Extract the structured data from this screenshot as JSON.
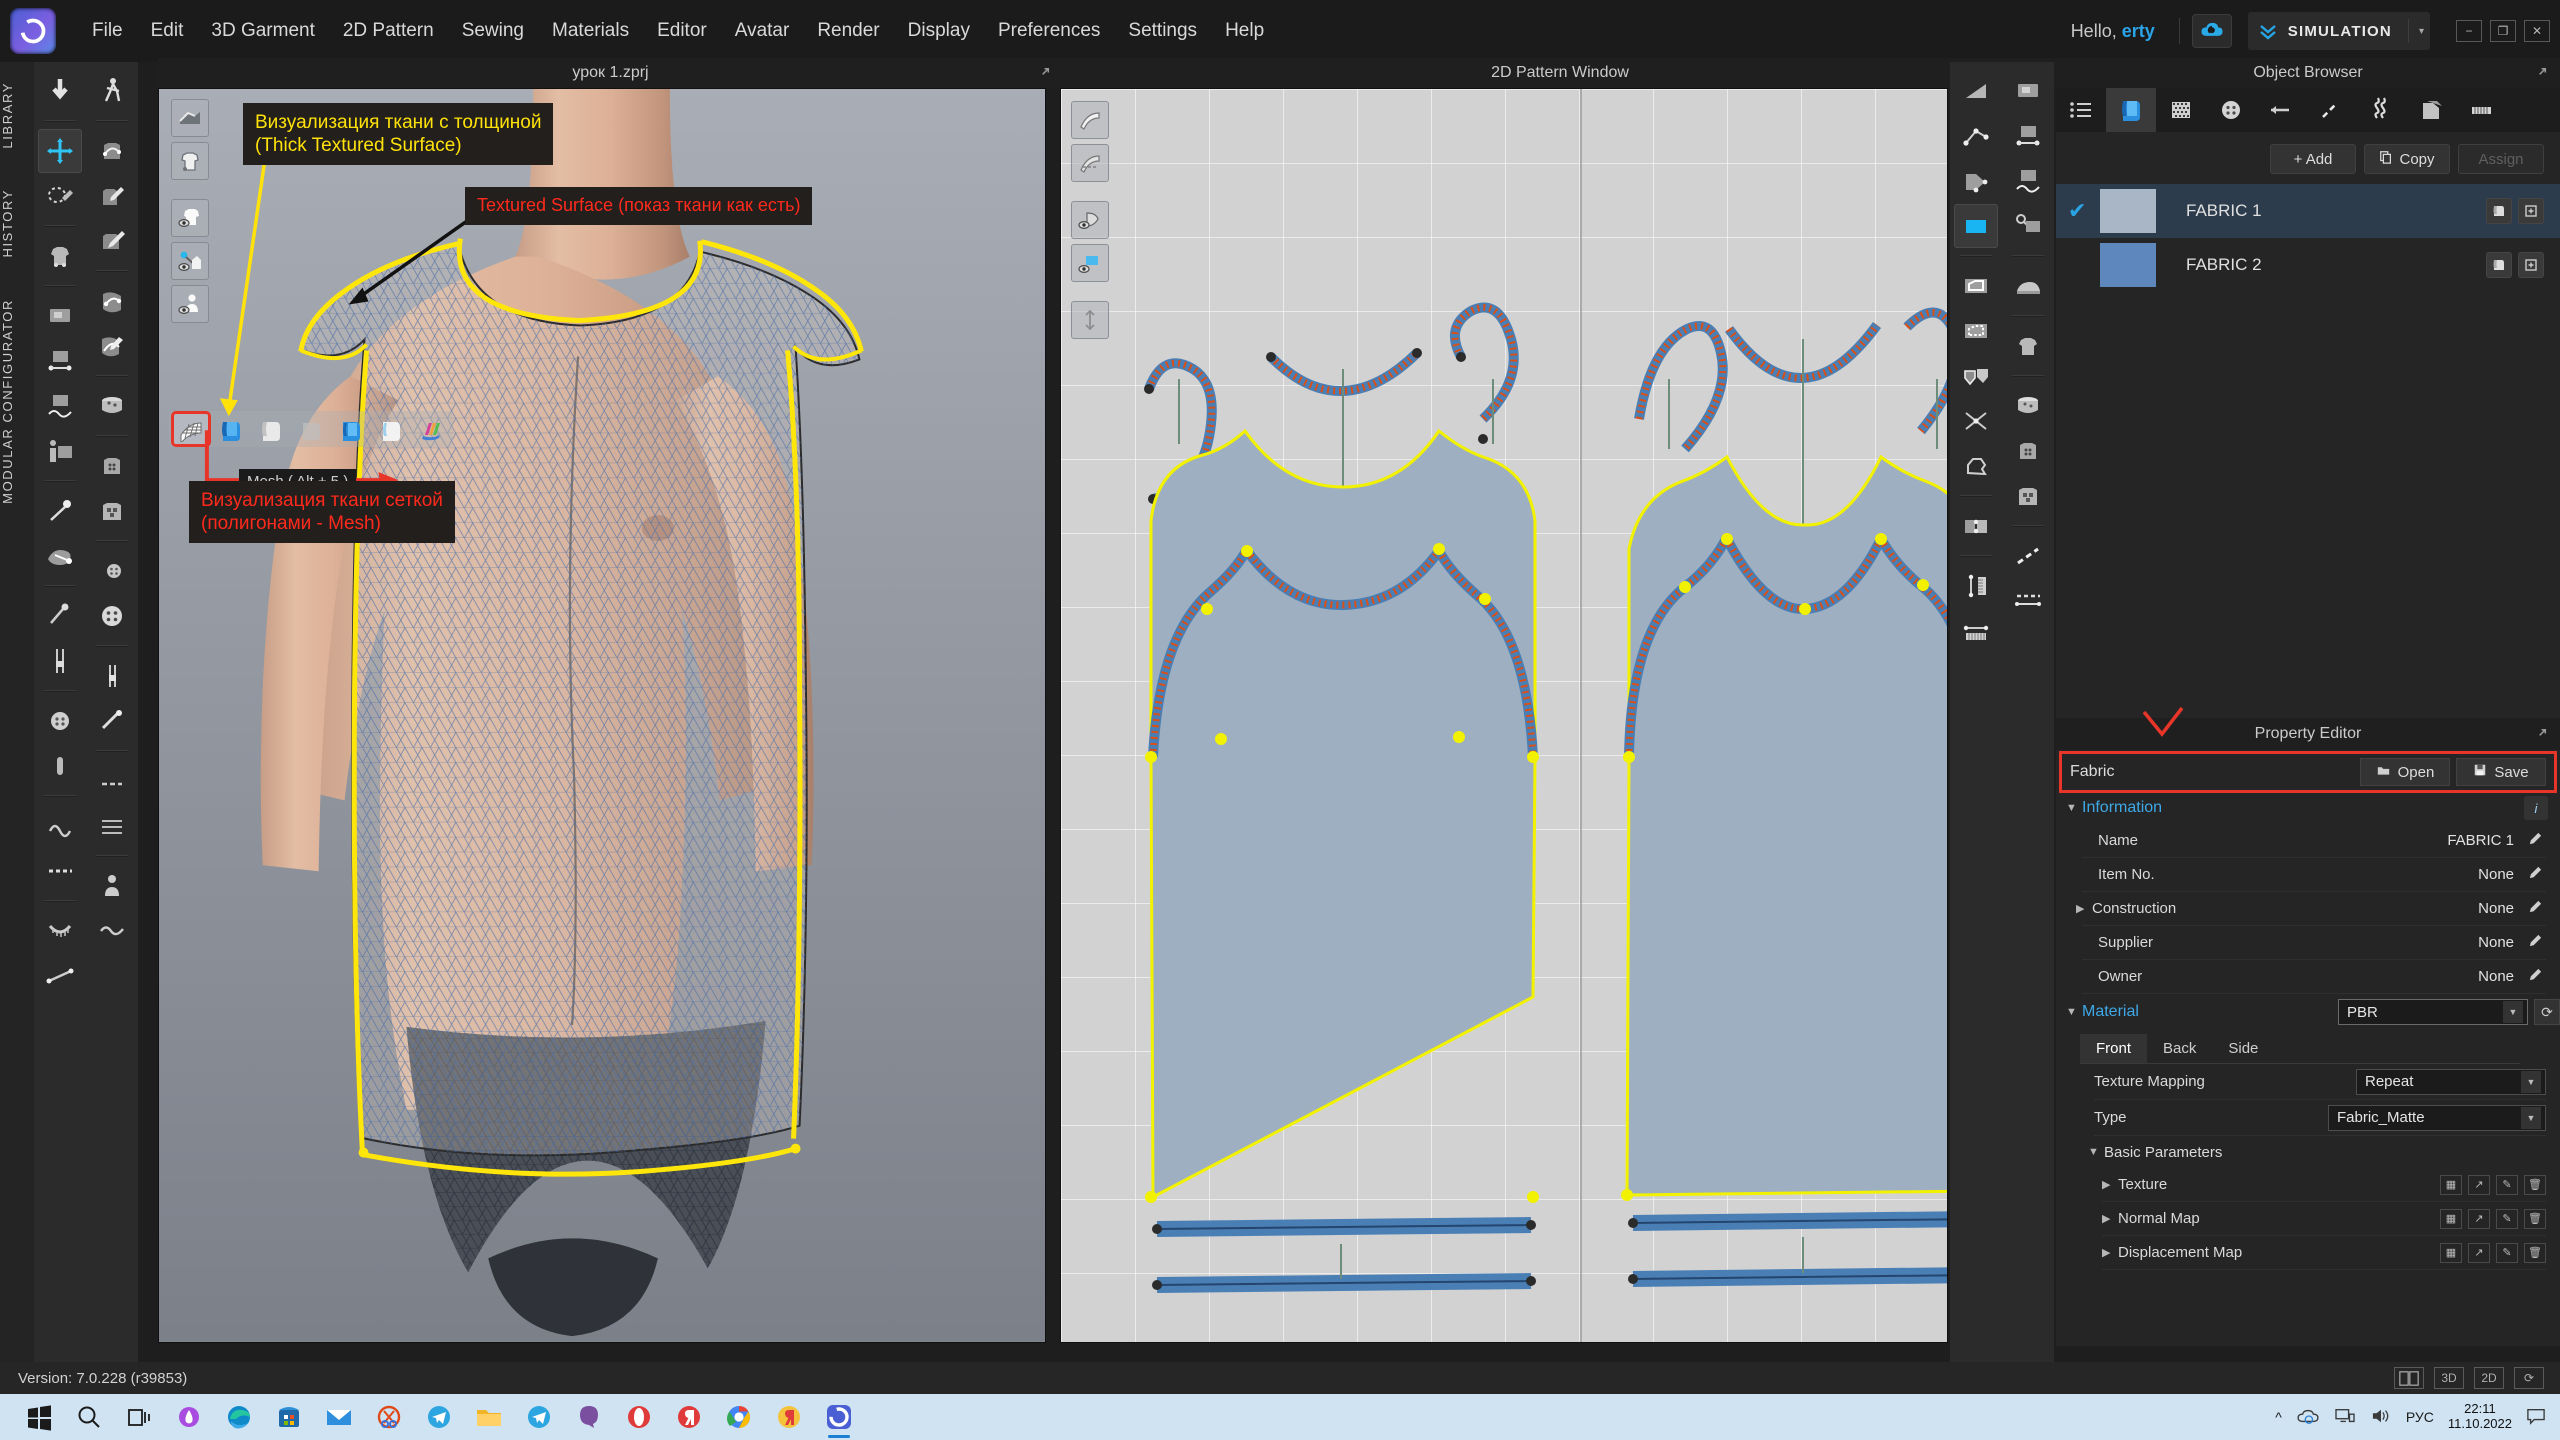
{
  "app": {
    "logo_icon": "clo-logo-icon",
    "version_status": "Version: 7.0.228 (r39853)"
  },
  "menubar": {
    "items": [
      "File",
      "Edit",
      "3D Garment",
      "2D Pattern",
      "Sewing",
      "Materials",
      "Editor",
      "Avatar",
      "Render",
      "Display",
      "Preferences",
      "Settings",
      "Help"
    ],
    "greeting_prefix": "Hello, ",
    "user": "erty",
    "cloud_icon": "cloud-icon",
    "mode_label": "SIMULATION",
    "mode_caret": "▾",
    "window_buttons": [
      "−",
      "❐",
      "✕"
    ]
  },
  "left_tabs": [
    "LIBRARY",
    "HISTORY",
    "MODULAR CONFIGURATOR"
  ],
  "view3d": {
    "title": "урок 1.zprj",
    "expand_icon": "expand-icon",
    "render_modes": [
      {
        "name": "mesh-render-mode",
        "label": "Mesh ( Alt + 5 )",
        "selected": true
      },
      {
        "name": "thick-textured-surface",
        "label": "Thick Textured Surface",
        "selected": false
      },
      {
        "name": "thick-surface",
        "label": "Thick Surface",
        "selected": false
      },
      {
        "name": "surface-mode",
        "label": "Surface",
        "selected": false
      },
      {
        "name": "textured-surface",
        "label": "Textured Surface",
        "selected": false
      },
      {
        "name": "translucent-surface",
        "label": "Translucent Surface",
        "selected": false
      },
      {
        "name": "color-map-mode",
        "label": "Color Map",
        "selected": false
      }
    ],
    "annotations": [
      {
        "id": "thick",
        "color": "#ffe20a",
        "text": "Визуализация ткани с толщиной\n(Thick Textured Surface)"
      },
      {
        "id": "textured",
        "color": "#ff2a1c",
        "text": "Textured Surface (показ ткани как есть)"
      },
      {
        "id": "mesh",
        "color": "#ff2a1c",
        "text": "Визуализация ткани сеткой\n(полигонами - Mesh)"
      },
      {
        "id": "tooltip",
        "color": "#cfcfcf",
        "text": "Mesh ( Alt + 5 )"
      }
    ]
  },
  "view2d": {
    "title": "2D Pattern Window",
    "expand_icon": "expand-icon"
  },
  "object_browser": {
    "title": "Object Browser",
    "expand_icon": "expand-icon",
    "tabs": [
      {
        "name": "tab-list",
        "icon": "list-icon",
        "selected": false
      },
      {
        "name": "tab-fabric",
        "icon": "fabric-book-icon",
        "selected": true
      },
      {
        "name": "tab-topstitch",
        "icon": "grid-dots-icon",
        "selected": false
      },
      {
        "name": "tab-button",
        "icon": "button-icon",
        "selected": false
      },
      {
        "name": "tab-trim",
        "icon": "line-icon",
        "selected": false
      },
      {
        "name": "tab-graphic",
        "icon": "dashed-line-icon",
        "selected": false
      },
      {
        "name": "tab-zipper",
        "icon": "zigzag-icon",
        "selected": false
      },
      {
        "name": "tab-fold",
        "icon": "fold-icon",
        "selected": false
      },
      {
        "name": "tab-measure",
        "icon": "ruler-icon",
        "selected": false
      }
    ],
    "buttons": {
      "add": "+ Add",
      "copy": "Copy",
      "assign": "Assign"
    },
    "fabrics": [
      {
        "name": "FABRIC 1",
        "color": "#a8b6c6",
        "checked": true,
        "selected": true
      },
      {
        "name": "FABRIC 2",
        "color": "#5d87bd",
        "checked": false,
        "selected": false
      }
    ]
  },
  "property_editor": {
    "title": "Property Editor",
    "expand_icon": "expand-icon",
    "fabric_label": "Fabric",
    "open_button": "Open",
    "save_button": "Save",
    "sections": {
      "information": {
        "label": "Information",
        "expanded": true,
        "rows": [
          {
            "key": "Name",
            "value": "FABRIC 1",
            "has_caret": false
          },
          {
            "key": "Item No.",
            "value": "None",
            "has_caret": false
          },
          {
            "key": "Construction",
            "value": "None",
            "has_caret": true
          },
          {
            "key": "Supplier",
            "value": "None",
            "has_caret": false
          },
          {
            "key": "Owner",
            "value": "None",
            "has_caret": false
          }
        ]
      },
      "material": {
        "label": "Material",
        "expanded": true,
        "shader": "PBR",
        "tabs": [
          {
            "label": "Front",
            "selected": true
          },
          {
            "label": "Back",
            "selected": false
          },
          {
            "label": "Side",
            "selected": false
          }
        ],
        "texture_mapping": {
          "key": "Texture Mapping",
          "value": "Repeat"
        },
        "type": {
          "key": "Type",
          "value": "Fabric_Matte"
        },
        "basic_parameters": {
          "label": "Basic Parameters",
          "maps": [
            "Texture",
            "Normal Map",
            "Displacement Map"
          ]
        }
      }
    }
  },
  "statusbar": {
    "version": "Version:  7.0.228 (r39853)",
    "view_modes": [
      "split-view",
      "3D",
      "2D",
      "reset-view"
    ]
  },
  "taskbar": {
    "icons": [
      "start-icon",
      "search-icon",
      "task-view-icon",
      "cortana-icon",
      "edge-icon",
      "store-icon",
      "mail-icon",
      "snip-icon",
      "telegram-icon",
      "folder-icon",
      "telegram2-icon",
      "viber-icon",
      "opera-icon",
      "yandex-icon",
      "chrome-icon",
      "yandex2-icon",
      "clo-icon"
    ],
    "tray": {
      "chevron": "^",
      "icons": [
        "onedrive-icon",
        "network-icon",
        "volume-icon"
      ],
      "language": "РУС",
      "time": "22:11",
      "date": "11.10.2022",
      "notification": "notification-icon"
    }
  }
}
